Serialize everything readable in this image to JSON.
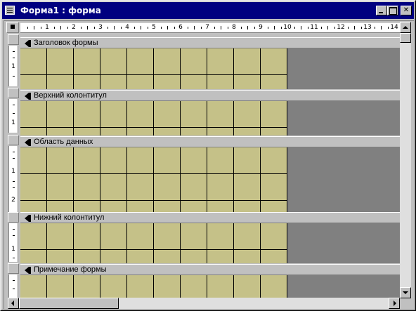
{
  "window": {
    "title": "Форма1 : форма",
    "colors": {
      "titlebar": "#000080",
      "grid_fill": "#c5c188",
      "form_background": "#808080",
      "chrome": "#c0c0c0"
    },
    "icons": [
      "form-window-icon",
      "minimize-icon",
      "maximize-icon",
      "close-icon"
    ]
  },
  "ruler": {
    "horizontal_numbers": [
      "1",
      "2",
      "3",
      "4",
      "5",
      "6",
      "7",
      "8",
      "9",
      "10",
      "11",
      "12",
      "13",
      "14"
    ],
    "vertical_numbers": [
      "1",
      "1",
      "1",
      "2",
      "1"
    ]
  },
  "sections": [
    {
      "label": "Заголовок формы"
    },
    {
      "label": "Верхний колонтитул"
    },
    {
      "label": "Область данных"
    },
    {
      "label": "Нижний колонтитул"
    },
    {
      "label": "Примечание формы"
    }
  ]
}
